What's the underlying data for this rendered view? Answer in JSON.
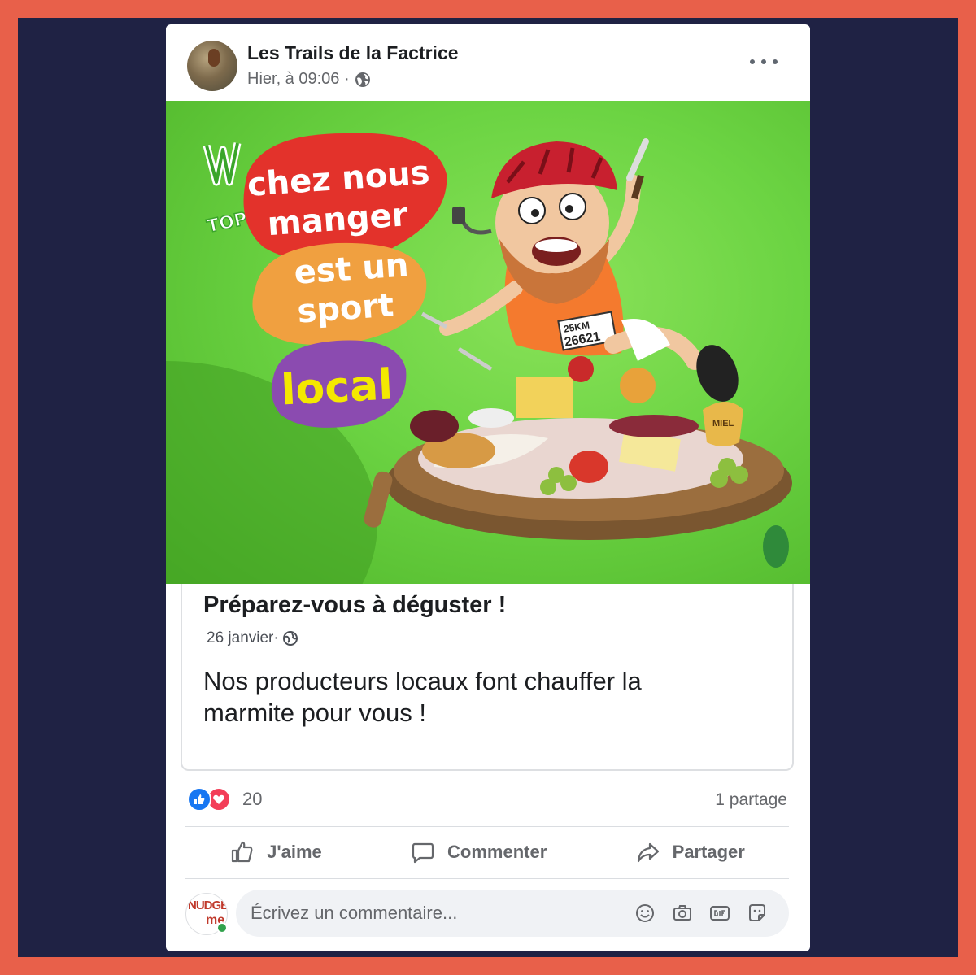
{
  "post": {
    "page_name": "Les Trails de la Factrice",
    "timestamp": "Hier, à 09:06 ·"
  },
  "illustration": {
    "line1": "chez nous",
    "line2": "manger",
    "line3": "est un",
    "line4": "sport",
    "line5": "local",
    "bib_top": "25KM",
    "bib_number": "26621",
    "badge": "TOP ECO",
    "miel_label": "MIEL"
  },
  "preview": {
    "title": "Préparez-vous à déguster !",
    "date": "26 janvier·",
    "text": "Nos producteurs locaux font chauffer la marmite pour vous !"
  },
  "reactions": {
    "count": "20",
    "shares": "1 partage"
  },
  "actions": {
    "like": "J'aime",
    "comment": "Commenter",
    "share": "Partager"
  },
  "comment": {
    "placeholder": "Écrivez un commentaire...",
    "avatar_text_top": "NUDGE",
    "avatar_text_bottom": "me"
  },
  "colors": {
    "background": "#e8604a",
    "frame": "#1f2244",
    "like_blue": "#1877f2",
    "love_red": "#f33e58",
    "illustration_green": "#6cd443",
    "blob_red": "#e3322b",
    "blob_orange": "#f0a040",
    "blob_purple": "#8b4bb0"
  }
}
